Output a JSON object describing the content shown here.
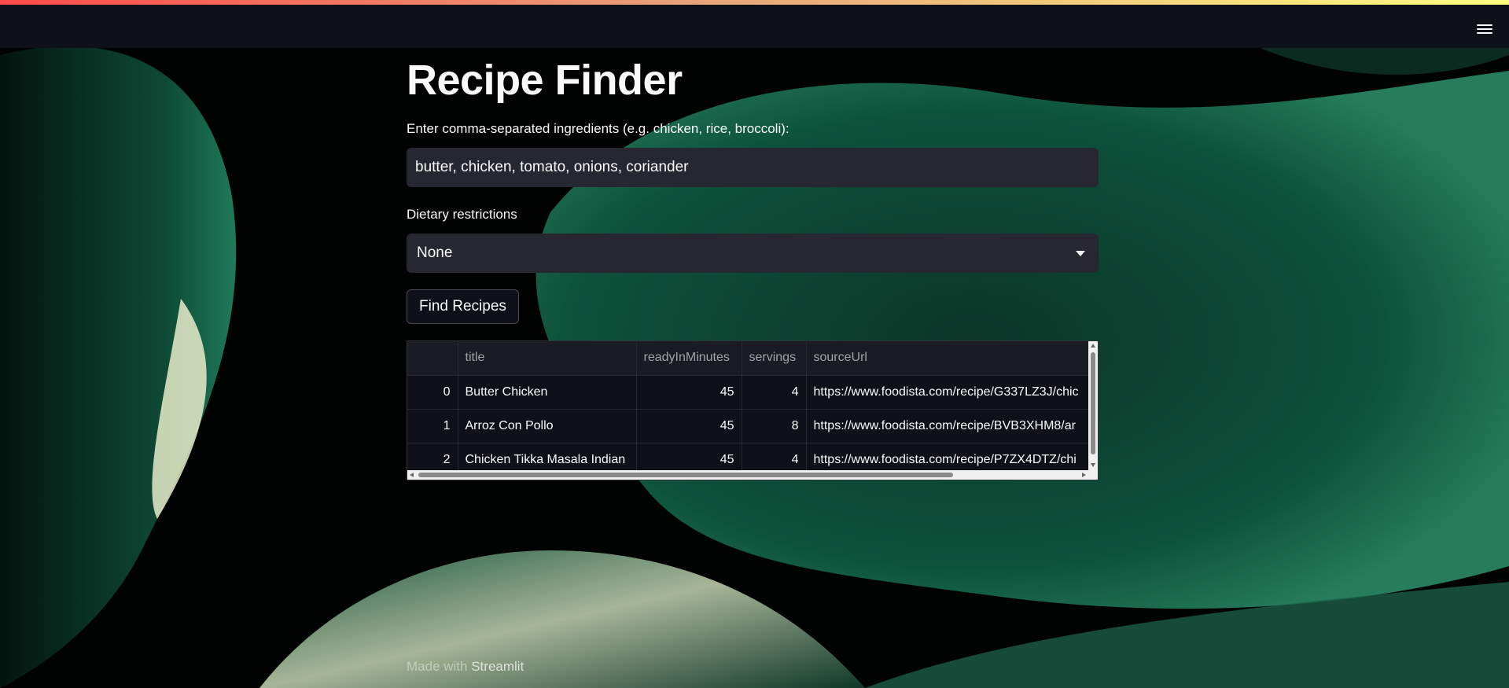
{
  "app": {
    "title": "Recipe Finder"
  },
  "form": {
    "ingredients_label": "Enter comma-separated ingredients (e.g. chicken, rice, broccoli):",
    "ingredients_value": "butter, chicken, tomato, onions, coriander",
    "diet_label": "Dietary restrictions",
    "diet_selected": "None",
    "submit_label": "Find Recipes"
  },
  "table": {
    "columns": [
      "",
      "title",
      "readyInMinutes",
      "servings",
      "sourceUrl"
    ],
    "rows": [
      {
        "index": "0",
        "title": "Butter Chicken",
        "readyInMinutes": "45",
        "servings": "4",
        "sourceUrl": "https://www.foodista.com/recipe/G337LZ3J/chic"
      },
      {
        "index": "1",
        "title": "Arroz Con Pollo",
        "readyInMinutes": "45",
        "servings": "8",
        "sourceUrl": "https://www.foodista.com/recipe/BVB3XHM8/ar"
      },
      {
        "index": "2",
        "title": "Chicken Tikka Masala Indian",
        "readyInMinutes": "45",
        "servings": "4",
        "sourceUrl": "https://www.foodista.com/recipe/P7ZX4DTZ/chi"
      }
    ]
  },
  "footer": {
    "prefix": "Made with",
    "brand": "Streamlit"
  },
  "colors": {
    "topbar": "#0e1117",
    "input_bg": "#262730",
    "accent_start": "#ff4b4b",
    "accent_end": "#fffd80"
  },
  "icons": {
    "menu": "hamburger-menu-icon",
    "select": "chevron-down-icon"
  }
}
